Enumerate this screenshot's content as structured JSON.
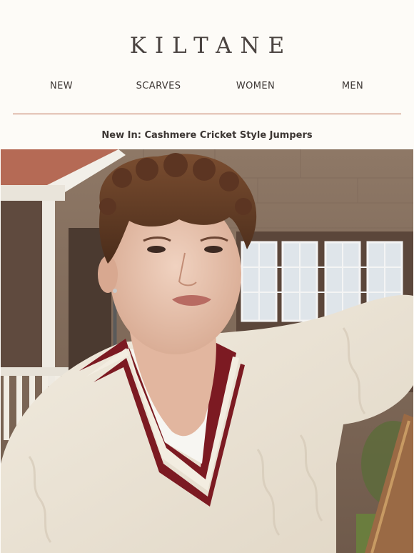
{
  "brand": {
    "logo": "KILTANE"
  },
  "nav": [
    {
      "label": "NEW"
    },
    {
      "label": "SCARVES"
    },
    {
      "label": "WOMEN"
    },
    {
      "label": "MEN"
    }
  ],
  "headline": "New In: Cashmere Cricket Style Jumpers",
  "colors": {
    "background": "#fdfbf7",
    "text": "#3c3633",
    "divider": "#b8654a",
    "jumper_stripe": "#7c1a22"
  }
}
